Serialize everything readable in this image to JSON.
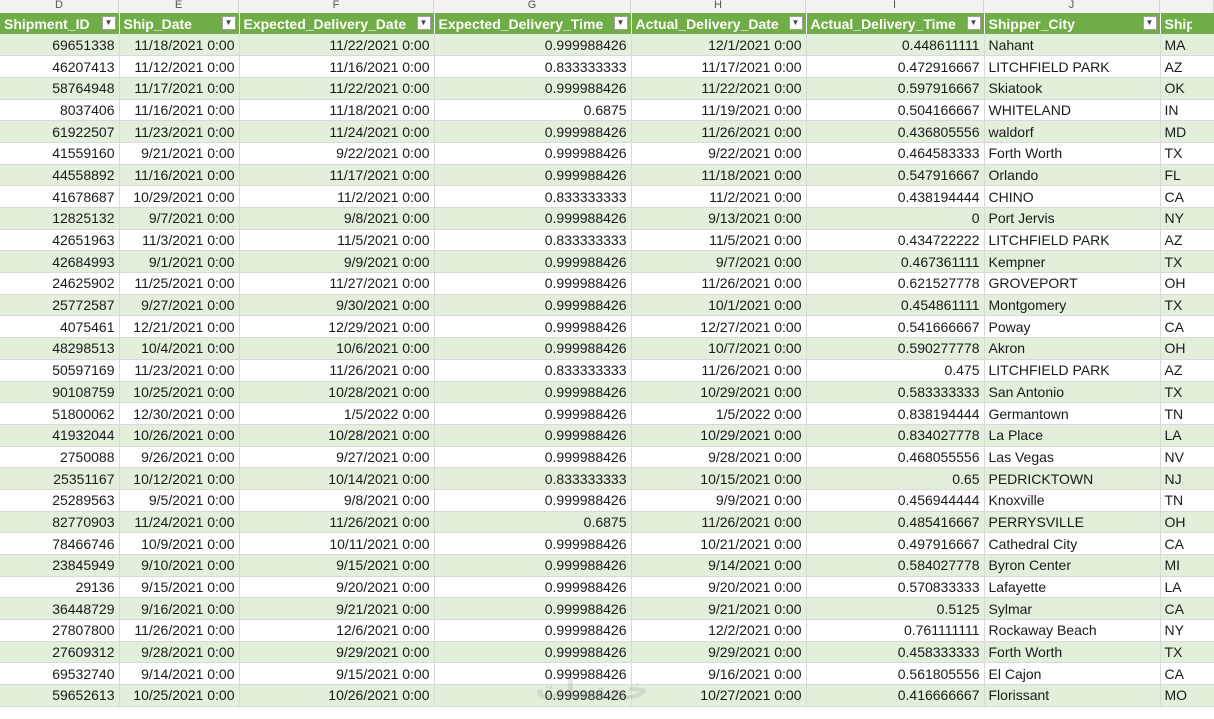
{
  "column_letters": [
    "D",
    "E",
    "F",
    "G",
    "H",
    "I",
    "J",
    ""
  ],
  "headers": [
    {
      "label": "Shipment_ID",
      "filter": "filter-dropdown"
    },
    {
      "label": "Ship_Date",
      "filter": "filter-dropdown"
    },
    {
      "label": "Expected_Delivery_Date",
      "filter": "filter-dropdown"
    },
    {
      "label": "Expected_Delivery_Time",
      "filter": "filter-dropdown"
    },
    {
      "label": "Actual_Delivery_Date",
      "filter": "filter-dropdown"
    },
    {
      "label": "Actual_Delivery_Time",
      "filter": "filter-dropdown"
    },
    {
      "label": "Shipper_City",
      "filter": "filter-dropdown"
    },
    {
      "label": "Shipper",
      "filter": ""
    }
  ],
  "rows": [
    [
      "69651338",
      "11/18/2021 0:00",
      "11/22/2021 0:00",
      "0.999988426",
      "12/1/2021 0:00",
      "0.448611111",
      "Nahant",
      "MA"
    ],
    [
      "46207413",
      "11/12/2021 0:00",
      "11/16/2021 0:00",
      "0.833333333",
      "11/17/2021 0:00",
      "0.472916667",
      "LITCHFIELD PARK",
      "AZ"
    ],
    [
      "58764948",
      "11/17/2021 0:00",
      "11/22/2021 0:00",
      "0.999988426",
      "11/22/2021 0:00",
      "0.597916667",
      "Skiatook",
      "OK"
    ],
    [
      "8037406",
      "11/16/2021 0:00",
      "11/18/2021 0:00",
      "0.6875",
      "11/19/2021 0:00",
      "0.504166667",
      "WHITELAND",
      "IN"
    ],
    [
      "61922507",
      "11/23/2021 0:00",
      "11/24/2021 0:00",
      "0.999988426",
      "11/26/2021 0:00",
      "0.436805556",
      "waldorf",
      "MD"
    ],
    [
      "41559160",
      "9/21/2021 0:00",
      "9/22/2021 0:00",
      "0.999988426",
      "9/22/2021 0:00",
      "0.464583333",
      "Forth Worth",
      "TX"
    ],
    [
      "44558892",
      "11/16/2021 0:00",
      "11/17/2021 0:00",
      "0.999988426",
      "11/18/2021 0:00",
      "0.547916667",
      "Orlando",
      "FL"
    ],
    [
      "41678687",
      "10/29/2021 0:00",
      "11/2/2021 0:00",
      "0.833333333",
      "11/2/2021 0:00",
      "0.438194444",
      "CHINO",
      "CA"
    ],
    [
      "12825132",
      "9/7/2021 0:00",
      "9/8/2021 0:00",
      "0.999988426",
      "9/13/2021 0:00",
      "0",
      "Port Jervis",
      "NY"
    ],
    [
      "42651963",
      "11/3/2021 0:00",
      "11/5/2021 0:00",
      "0.833333333",
      "11/5/2021 0:00",
      "0.434722222",
      "LITCHFIELD PARK",
      "AZ"
    ],
    [
      "42684993",
      "9/1/2021 0:00",
      "9/9/2021 0:00",
      "0.999988426",
      "9/7/2021 0:00",
      "0.467361111",
      "Kempner",
      "TX"
    ],
    [
      "24625902",
      "11/25/2021 0:00",
      "11/27/2021 0:00",
      "0.999988426",
      "11/26/2021 0:00",
      "0.621527778",
      "GROVEPORT",
      "OH"
    ],
    [
      "25772587",
      "9/27/2021 0:00",
      "9/30/2021 0:00",
      "0.999988426",
      "10/1/2021 0:00",
      "0.454861111",
      "Montgomery",
      "TX"
    ],
    [
      "4075461",
      "12/21/2021 0:00",
      "12/29/2021 0:00",
      "0.999988426",
      "12/27/2021 0:00",
      "0.541666667",
      "Poway",
      "CA"
    ],
    [
      "48298513",
      "10/4/2021 0:00",
      "10/6/2021 0:00",
      "0.999988426",
      "10/7/2021 0:00",
      "0.590277778",
      "Akron",
      "OH"
    ],
    [
      "50597169",
      "11/23/2021 0:00",
      "11/26/2021 0:00",
      "0.833333333",
      "11/26/2021 0:00",
      "0.475",
      "LITCHFIELD PARK",
      "AZ"
    ],
    [
      "90108759",
      "10/25/2021 0:00",
      "10/28/2021 0:00",
      "0.999988426",
      "10/29/2021 0:00",
      "0.583333333",
      "San Antonio",
      "TX"
    ],
    [
      "51800062",
      "12/30/2021 0:00",
      "1/5/2022 0:00",
      "0.999988426",
      "1/5/2022 0:00",
      "0.838194444",
      "Germantown",
      "TN"
    ],
    [
      "41932044",
      "10/26/2021 0:00",
      "10/28/2021 0:00",
      "0.999988426",
      "10/29/2021 0:00",
      "0.834027778",
      "La Place",
      "LA"
    ],
    [
      "2750088",
      "9/26/2021 0:00",
      "9/27/2021 0:00",
      "0.999988426",
      "9/28/2021 0:00",
      "0.468055556",
      "Las Vegas",
      "NV"
    ],
    [
      "25351167",
      "10/12/2021 0:00",
      "10/14/2021 0:00",
      "0.833333333",
      "10/15/2021 0:00",
      "0.65",
      "PEDRICKTOWN",
      "NJ"
    ],
    [
      "25289563",
      "9/5/2021 0:00",
      "9/8/2021 0:00",
      "0.999988426",
      "9/9/2021 0:00",
      "0.456944444",
      "Knoxville",
      "TN"
    ],
    [
      "82770903",
      "11/24/2021 0:00",
      "11/26/2021 0:00",
      "0.6875",
      "11/26/2021 0:00",
      "0.485416667",
      "PERRYSVILLE",
      "OH"
    ],
    [
      "78466746",
      "10/9/2021 0:00",
      "10/11/2021 0:00",
      "0.999988426",
      "10/21/2021 0:00",
      "0.497916667",
      "Cathedral City",
      "CA"
    ],
    [
      "23845949",
      "9/10/2021 0:00",
      "9/15/2021 0:00",
      "0.999988426",
      "9/14/2021 0:00",
      "0.584027778",
      "Byron Center",
      "MI"
    ],
    [
      "29136",
      "9/15/2021 0:00",
      "9/20/2021 0:00",
      "0.999988426",
      "9/20/2021 0:00",
      "0.570833333",
      "Lafayette",
      "LA"
    ],
    [
      "36448729",
      "9/16/2021 0:00",
      "9/21/2021 0:00",
      "0.999988426",
      "9/21/2021 0:00",
      "0.5125",
      "Sylmar",
      "CA"
    ],
    [
      "27807800",
      "11/26/2021 0:00",
      "12/6/2021 0:00",
      "0.999988426",
      "12/2/2021 0:00",
      "0.761111111",
      "Rockaway Beach",
      "NY"
    ],
    [
      "27609312",
      "9/28/2021 0:00",
      "9/29/2021 0:00",
      "0.999988426",
      "9/29/2021 0:00",
      "0.458333333",
      "Forth Worth",
      "TX"
    ],
    [
      "69532740",
      "9/14/2021 0:00",
      "9/15/2021 0:00",
      "0.999988426",
      "9/16/2021 0:00",
      "0.561805556",
      "El Cajon",
      "CA"
    ],
    [
      "59652613",
      "10/25/2021 0:00",
      "10/26/2021 0:00",
      "0.999988426",
      "10/27/2021 0:00",
      "0.416666667",
      "Florissant",
      "MO"
    ]
  ],
  "watermark_text": "خمسات"
}
